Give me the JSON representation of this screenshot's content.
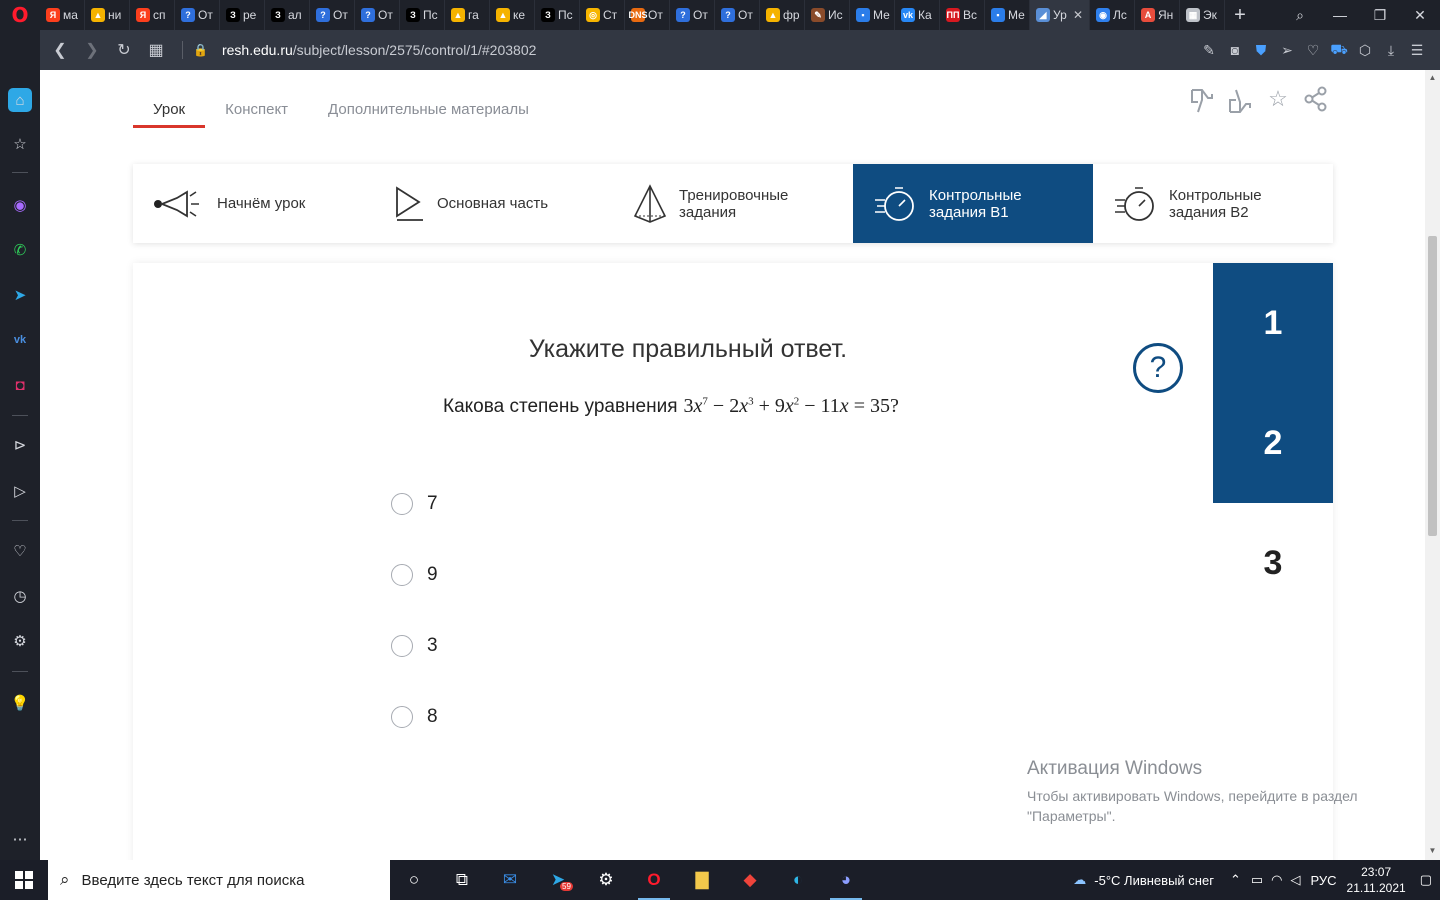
{
  "browser": {
    "tabs": [
      {
        "label": "ма",
        "fav": "Я",
        "color": "#fc3f1d"
      },
      {
        "label": "ни",
        "fav": "▲",
        "color": "#f5b300"
      },
      {
        "label": "сп",
        "fav": "Я",
        "color": "#fc3f1d"
      },
      {
        "label": "От",
        "fav": "?",
        "color": "#2f6fdc"
      },
      {
        "label": "ре",
        "fav": "З",
        "color": "#000000"
      },
      {
        "label": "ал",
        "fav": "З",
        "color": "#000000"
      },
      {
        "label": "От",
        "fav": "?",
        "color": "#2f6fdc"
      },
      {
        "label": "От",
        "fav": "?",
        "color": "#2f6fdc"
      },
      {
        "label": "Пс",
        "fav": "З",
        "color": "#000000"
      },
      {
        "label": "га",
        "fav": "▲",
        "color": "#f5b300"
      },
      {
        "label": "ке",
        "fav": "▲",
        "color": "#f5b300"
      },
      {
        "label": "Пс",
        "fav": "З",
        "color": "#000000"
      },
      {
        "label": "Ст",
        "fav": "◎",
        "color": "#f7b500"
      },
      {
        "label": "От",
        "fav": "DNS",
        "color": "#e86a10"
      },
      {
        "label": "От",
        "fav": "?",
        "color": "#2f6fdc"
      },
      {
        "label": "От",
        "fav": "?",
        "color": "#2f6fdc"
      },
      {
        "label": "фр",
        "fav": "▲",
        "color": "#f5b300"
      },
      {
        "label": "Ис",
        "fav": "✎",
        "color": "#8a4b2a"
      },
      {
        "label": "Ме",
        "fav": "▪",
        "color": "#2b7de9"
      },
      {
        "label": "Ка",
        "fav": "vk",
        "color": "#2787f5"
      },
      {
        "label": "Вс",
        "fav": "ПП",
        "color": "#d71920"
      },
      {
        "label": "Ме",
        "fav": "▪",
        "color": "#2b7de9"
      },
      {
        "label": "Ур",
        "fav": "◢",
        "color": "#5a8fd6",
        "active": true
      },
      {
        "label": "Лс",
        "fav": "◉",
        "color": "#2f80ed"
      },
      {
        "label": "Ян",
        "fav": "А",
        "color": "#e74c3c"
      },
      {
        "label": "Эк",
        "fav": "▦",
        "color": "#bfc3ca"
      }
    ],
    "url_domain": "resh.edu.ru",
    "url_path": "/subject/lesson/2575/control/1/#203802"
  },
  "lesson_tabs": [
    "Урок",
    "Конспект",
    "Дополнительные материалы"
  ],
  "steps": [
    {
      "label_line1": "Начнём урок",
      "label_line2": ""
    },
    {
      "label_line1": "Основная часть",
      "label_line2": ""
    },
    {
      "label_line1": "Тренировочные",
      "label_line2": "задания"
    },
    {
      "label_line1": "Контрольные",
      "label_line2": "задания В1"
    },
    {
      "label_line1": "Контрольные",
      "label_line2": "задания В2"
    }
  ],
  "question": {
    "title": "Укажите правильный ответ.",
    "text": "Какова степень уравнения",
    "formula": {
      "c1": "3",
      "e1": "7",
      "c2": "2",
      "e2": "3",
      "c3": "9",
      "e3": "2",
      "c4": "11",
      "rhs": "35"
    },
    "help": "?",
    "options": [
      "7",
      "9",
      "3",
      "8"
    ]
  },
  "question_numbers": [
    "1",
    "2",
    "3"
  ],
  "watermark": {
    "title": "Активация Windows",
    "line1": "Чтобы активировать Windows, перейдите в раздел",
    "line2": "\"Параметры\"."
  },
  "taskbar": {
    "search_placeholder": "Введите здесь текст для поиска",
    "telegram_badge": "59",
    "weather": "-5°C  Ливневый снег",
    "lang": "РУС",
    "time": "23:07",
    "date": "21.11.2021"
  }
}
